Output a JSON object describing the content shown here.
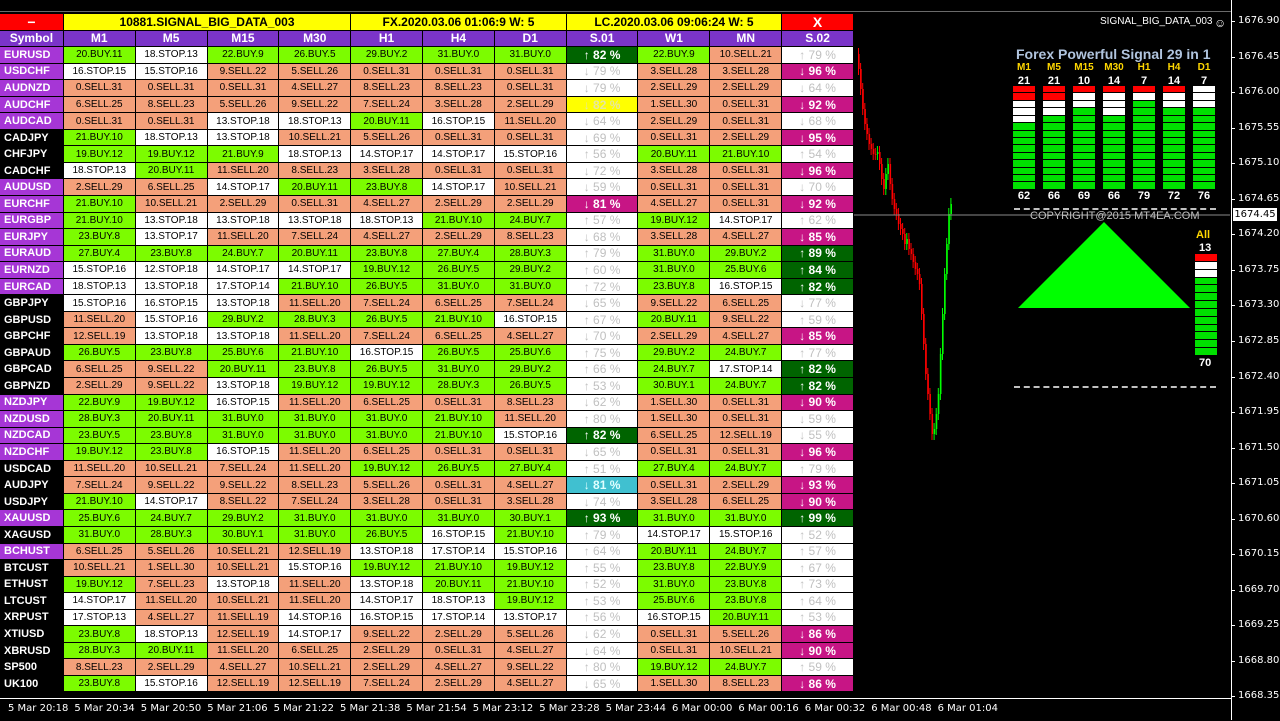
{
  "header": {
    "minimize": "−",
    "title": "10881.SIGNAL_BIG_DATA_003",
    "fx_time": "FX.2020.03.06 01:06:9 W: 5",
    "lc_time": "LC.2020.03.06 09:06:24 W: 5",
    "close": "X"
  },
  "columns": [
    "Symbol",
    "M1",
    "M5",
    "M15",
    "M30",
    "H1",
    "H4",
    "D1",
    "S.01",
    "W1",
    "MN",
    "S.02"
  ],
  "rows": [
    [
      "EURUSD",
      "20.BUY.11",
      "18.STOP.13",
      "22.BUY.9",
      "26.BUY.5",
      "29.BUY.2",
      "31.BUY.0",
      "31.BUY.0",
      "↑ 82 %",
      "22.BUY.9",
      "10.SELL.21",
      "↑ 79 %"
    ],
    [
      "USDCHF",
      "16.STOP.15",
      "15.STOP.16",
      "9.SELL.22",
      "5.SELL.26",
      "0.SELL.31",
      "0.SELL.31",
      "0.SELL.31",
      "↓ 79 %",
      "3.SELL.28",
      "3.SELL.28",
      "↓ 96 %"
    ],
    [
      "AUDNZD",
      "0.SELL.31",
      "0.SELL.31",
      "0.SELL.31",
      "4.SELL.27",
      "8.SELL.23",
      "8.SELL.23",
      "0.SELL.31",
      "↓ 79 %",
      "2.SELL.29",
      "2.SELL.29",
      "↓ 64 %"
    ],
    [
      "AUDCHF",
      "6.SELL.25",
      "8.SELL.23",
      "5.SELL.26",
      "9.SELL.22",
      "7.SELL.24",
      "3.SELL.28",
      "2.SELL.29",
      "↓ 82 %",
      "1.SELL.30",
      "0.SELL.31",
      "↓ 92 %"
    ],
    [
      "AUDCAD",
      "0.SELL.31",
      "0.SELL.31",
      "13.STOP.18",
      "18.STOP.13",
      "20.BUY.11",
      "16.STOP.15",
      "11.SELL.20",
      "↓ 64 %",
      "2.SELL.29",
      "0.SELL.31",
      "↓ 68 %"
    ],
    [
      "CADJPY",
      "21.BUY.10",
      "18.STOP.13",
      "13.STOP.18",
      "10.SELL.21",
      "5.SELL.26",
      "0.SELL.31",
      "0.SELL.31",
      "↓ 69 %",
      "0.SELL.31",
      "2.SELL.29",
      "↓ 95 %"
    ],
    [
      "CHFJPY",
      "19.BUY.12",
      "19.BUY.12",
      "21.BUY.9",
      "18.STOP.13",
      "14.STOP.17",
      "14.STOP.17",
      "15.STOP.16",
      "↑ 56 %",
      "20.BUY.11",
      "21.BUY.10",
      "↑ 54 %"
    ],
    [
      "CADCHF",
      "18.STOP.13",
      "20.BUY.11",
      "11.SELL.20",
      "8.SELL.23",
      "3.SELL.28",
      "0.SELL.31",
      "0.SELL.31",
      "↓ 72 %",
      "3.SELL.28",
      "0.SELL.31",
      "↓ 96 %"
    ],
    [
      "AUDUSD",
      "2.SELL.29",
      "6.SELL.25",
      "14.STOP.17",
      "20.BUY.11",
      "23.BUY.8",
      "14.STOP.17",
      "10.SELL.21",
      "↓ 59 %",
      "0.SELL.31",
      "0.SELL.31",
      "↓ 70 %"
    ],
    [
      "EURCHF",
      "21.BUY.10",
      "10.SELL.21",
      "2.SELL.29",
      "0.SELL.31",
      "4.SELL.27",
      "2.SELL.29",
      "2.SELL.29",
      "↓ 81 %",
      "4.SELL.27",
      "0.SELL.31",
      "↓ 92 %"
    ],
    [
      "EURGBP",
      "21.BUY.10",
      "13.STOP.18",
      "13.STOP.18",
      "13.STOP.18",
      "18.STOP.13",
      "21.BUY.10",
      "24.BUY.7",
      "↑ 57 %",
      "19.BUY.12",
      "14.STOP.17",
      "↑ 62 %"
    ],
    [
      "EURJPY",
      "23.BUY.8",
      "13.STOP.17",
      "11.SELL.20",
      "7.SELL.24",
      "4.SELL.27",
      "2.SELL.29",
      "8.SELL.23",
      "↓ 68 %",
      "3.SELL.28",
      "4.SELL.27",
      "↓ 85 %"
    ],
    [
      "EURAUD",
      "27.BUY.4",
      "23.BUY.8",
      "24.BUY.7",
      "20.BUY.11",
      "23.BUY.8",
      "27.BUY.4",
      "28.BUY.3",
      "↑ 79 %",
      "31.BUY.0",
      "29.BUY.2",
      "↑ 89 %"
    ],
    [
      "EURNZD",
      "15.STOP.16",
      "12.STOP.18",
      "14.STOP.17",
      "14.STOP.17",
      "19.BUY.12",
      "26.BUY.5",
      "29.BUY.2",
      "↑ 60 %",
      "31.BUY.0",
      "25.BUY.6",
      "↑ 84 %"
    ],
    [
      "EURCAD",
      "18.STOP.13",
      "13.STOP.18",
      "17.STOP.14",
      "21.BUY.10",
      "26.BUY.5",
      "31.BUY.0",
      "31.BUY.0",
      "↑ 72 %",
      "23.BUY.8",
      "16.STOP.15",
      "↑ 82 %"
    ],
    [
      "GBPJPY",
      "15.STOP.16",
      "16.STOP.15",
      "13.STOP.18",
      "11.SELL.20",
      "7.SELL.24",
      "6.SELL.25",
      "7.SELL.24",
      "↓ 65 %",
      "9.SELL.22",
      "6.SELL.25",
      "↓ 77 %"
    ],
    [
      "GBPUSD",
      "11.SELL.20",
      "15.STOP.16",
      "29.BUY.2",
      "28.BUY.3",
      "26.BUY.5",
      "21.BUY.10",
      "16.STOP.15",
      "↑ 67 %",
      "20.BUY.11",
      "9.SELL.22",
      "↑ 59 %"
    ],
    [
      "GBPCHF",
      "12.SELL.19",
      "13.STOP.18",
      "13.STOP.18",
      "11.SELL.20",
      "7.SELL.24",
      "6.SELL.25",
      "4.SELL.27",
      "↓ 70 %",
      "2.SELL.29",
      "4.SELL.27",
      "↓ 85 %"
    ],
    [
      "GBPAUD",
      "26.BUY.5",
      "23.BUY.8",
      "25.BUY.6",
      "21.BUY.10",
      "16.STOP.15",
      "26.BUY.5",
      "25.BUY.6",
      "↑ 75 %",
      "29.BUY.2",
      "24.BUY.7",
      "↑ 77 %"
    ],
    [
      "GBPCAD",
      "6.SELL.25",
      "9.SELL.22",
      "20.BUY.11",
      "23.BUY.8",
      "26.BUY.5",
      "31.BUY.0",
      "29.BUY.2",
      "↑ 66 %",
      "24.BUY.7",
      "17.STOP.14",
      "↑ 82 %"
    ],
    [
      "GBPNZD",
      "2.SELL.29",
      "9.SELL.22",
      "13.STOP.18",
      "19.BUY.12",
      "19.BUY.12",
      "28.BUY.3",
      "26.BUY.5",
      "↑ 53 %",
      "30.BUY.1",
      "24.BUY.7",
      "↑ 82 %"
    ],
    [
      "NZDJPY",
      "22.BUY.9",
      "19.BUY.12",
      "16.STOP.15",
      "11.SELL.20",
      "6.SELL.25",
      "0.SELL.31",
      "8.SELL.23",
      "↓ 62 %",
      "1.SELL.30",
      "0.SELL.31",
      "↓ 90 %"
    ],
    [
      "NZDUSD",
      "28.BUY.3",
      "20.BUY.11",
      "31.BUY.0",
      "31.BUY.0",
      "31.BUY.0",
      "21.BUY.10",
      "11.SELL.20",
      "↑ 80 %",
      "1.SELL.30",
      "0.SELL.31",
      "↓ 59 %"
    ],
    [
      "NZDCAD",
      "23.BUY.5",
      "23.BUY.8",
      "31.BUY.0",
      "31.BUY.0",
      "31.BUY.0",
      "21.BUY.10",
      "15.STOP.16",
      "↑ 82 %",
      "6.SELL.25",
      "12.SELL.19",
      "↓ 55 %"
    ],
    [
      "NZDCHF",
      "19.BUY.12",
      "23.BUY.8",
      "16.STOP.15",
      "11.SELL.20",
      "6.SELL.25",
      "0.SELL.31",
      "0.SELL.31",
      "↓ 65 %",
      "0.SELL.31",
      "0.SELL.31",
      "↓ 96 %"
    ],
    [
      "USDCAD",
      "11.SELL.20",
      "10.SELL.21",
      "7.SELL.24",
      "11.SELL.20",
      "19.BUY.12",
      "26.BUY.5",
      "27.BUY.4",
      "↑ 51 %",
      "27.BUY.4",
      "24.BUY.7",
      "↑ 79 %"
    ],
    [
      "AUDJPY",
      "7.SELL.24",
      "9.SELL.22",
      "9.SELL.22",
      "8.SELL.23",
      "5.SELL.26",
      "0.SELL.31",
      "4.SELL.27",
      "↓ 81 %",
      "0.SELL.31",
      "2.SELL.29",
      "↓ 93 %"
    ],
    [
      "USDJPY",
      "21.BUY.10",
      "14.STOP.17",
      "8.SELL.22",
      "7.SELL.24",
      "3.SELL.28",
      "0.SELL.31",
      "3.SELL.28",
      "↓ 74 %",
      "3.SELL.28",
      "6.SELL.25",
      "↓ 90 %"
    ],
    [
      "XAUUSD",
      "25.BUY.6",
      "24.BUY.7",
      "29.BUY.2",
      "31.BUY.0",
      "31.BUY.0",
      "31.BUY.0",
      "30.BUY.1",
      "↑ 93 %",
      "31.BUY.0",
      "31.BUY.0",
      "↑ 99 %"
    ],
    [
      "XAGUSD",
      "31.BUY.0",
      "28.BUY.3",
      "30.BUY.1",
      "31.BUY.0",
      "26.BUY.5",
      "16.STOP.15",
      "21.BUY.10",
      "↑ 79 %",
      "14.STOP.17",
      "15.STOP.16",
      "↑ 52 %"
    ],
    [
      "BCHUST",
      "6.SELL.25",
      "5.SELL.26",
      "10.SELL.21",
      "12.SELL.19",
      "13.STOP.18",
      "17.STOP.14",
      "15.STOP.16",
      "↑ 64 %",
      "20.BUY.11",
      "24.BUY.7",
      "↑ 57 %"
    ],
    [
      "BTCUST",
      "10.SELL.21",
      "1.SELL.30",
      "10.SELL.21",
      "15.STOP.16",
      "19.BUY.12",
      "21.BUY.10",
      "19.BUY.12",
      "↑ 55 %",
      "23.BUY.8",
      "22.BUY.9",
      "↑ 67 %"
    ],
    [
      "ETHUST",
      "19.BUY.12",
      "7.SELL.23",
      "13.STOP.18",
      "11.SELL.20",
      "13.STOP.18",
      "20.BUY.11",
      "21.BUY.10",
      "↑ 52 %",
      "31.BUY.0",
      "23.BUY.8",
      "↑ 73 %"
    ],
    [
      "LTCUST",
      "14.STOP.17",
      "11.SELL.20",
      "10.SELL.21",
      "11.SELL.20",
      "14.STOP.17",
      "18.STOP.13",
      "19.BUY.12",
      "↑ 53 %",
      "25.BUY.6",
      "23.BUY.8",
      "↑ 64 %"
    ],
    [
      "XRPUST",
      "17.STOP.13",
      "4.SELL.27",
      "11.SELL.19",
      "14.STOP.16",
      "16.STOP.15",
      "17.STOP.14",
      "13.STOP.17",
      "↑ 56 %",
      "16.STOP.15",
      "20.BUY.11",
      "↑ 53 %"
    ],
    [
      "XTIUSD",
      "23.BUY.8",
      "18.STOP.13",
      "12.SELL.19",
      "14.STOP.17",
      "9.SELL.22",
      "2.SELL.29",
      "5.SELL.26",
      "↓ 62 %",
      "0.SELL.31",
      "5.SELL.26",
      "↓ 86 %"
    ],
    [
      "XBRUSD",
      "28.BUY.3",
      "20.BUY.11",
      "11.SELL.20",
      "6.SELL.25",
      "2.SELL.29",
      "0.SELL.31",
      "4.SELL.27",
      "↓ 64 %",
      "0.SELL.31",
      "10.SELL.21",
      "↓ 90 %"
    ],
    [
      "SP500",
      "8.SELL.23",
      "2.SELL.29",
      "4.SELL.27",
      "10.SELL.21",
      "2.SELL.29",
      "4.SELL.27",
      "9.SELL.22",
      "↑ 80 %",
      "19.BUY.12",
      "24.BUY.7",
      "↑ 59 %"
    ],
    [
      "UK100",
      "23.BUY.8",
      "15.STOP.16",
      "12.SELL.19",
      "12.SELL.19",
      "7.SELL.24",
      "2.SELL.29",
      "4.SELL.27",
      "↓ 65 %",
      "1.SELL.30",
      "8.SELL.23",
      "↓ 86 %"
    ]
  ],
  "symbol_styles": [
    "p",
    "p",
    "p",
    "p",
    "p",
    "b",
    "b",
    "b",
    "p",
    "p",
    "p",
    "p",
    "p",
    "p",
    "p",
    "b",
    "b",
    "b",
    "b",
    "b",
    "b",
    "p",
    "p",
    "p",
    "p",
    "b",
    "b",
    "b",
    "p",
    "b",
    "p",
    "b",
    "b",
    "b",
    "b",
    "b",
    "b",
    "b",
    "b"
  ],
  "s01_styles": [
    "g",
    "w",
    "w",
    "y",
    "w",
    "w",
    "w",
    "w",
    "w",
    "m",
    "w",
    "w",
    "w",
    "w",
    "w",
    "w",
    "w",
    "w",
    "w",
    "w",
    "w",
    "w",
    "w",
    "g",
    "w",
    "w",
    "c",
    "w",
    "g",
    "w",
    "w",
    "w",
    "w",
    "w",
    "w",
    "w",
    "w",
    "w",
    "w"
  ],
  "s02_styles": [
    "w",
    "m",
    "w",
    "m",
    "w",
    "m",
    "w",
    "m",
    "w",
    "m",
    "w",
    "m",
    "g",
    "g",
    "g",
    "w",
    "w",
    "m",
    "w",
    "g",
    "g",
    "m",
    "w",
    "w",
    "m",
    "w",
    "m",
    "m",
    "g",
    "w",
    "w",
    "w",
    "w",
    "w",
    "w",
    "m",
    "m",
    "w",
    "m"
  ],
  "chart": {
    "indicator_name": "SIGNAL_BIG_DATA_003",
    "price_labels": [
      "1676.90",
      "1676.45",
      "1676.00",
      "1675.55",
      "1675.10",
      "1674.65",
      "1674.20",
      "1673.75",
      "1673.30",
      "1672.85",
      "1672.40",
      "1671.95",
      "1671.50",
      "1671.05",
      "1670.60",
      "1670.15",
      "1669.70",
      "1669.25",
      "1668.80",
      "1668.35"
    ],
    "current_price": "1674.45",
    "time_labels": [
      "5 Mar 20:18",
      "5 Mar 20:34",
      "5 Mar 20:50",
      "5 Mar 21:06",
      "5 Mar 21:22",
      "5 Mar 21:38",
      "5 Mar 21:54",
      "5 Mar 23:12",
      "5 Mar 23:28",
      "5 Mar 23:44",
      "6 Mar 00:00",
      "6 Mar 00:16",
      "6 Mar 00:32",
      "6 Mar 00:48",
      "6 Mar 01:04"
    ]
  },
  "panel": {
    "title": "Forex Powerful Signal 29 in 1",
    "timeframes": [
      {
        "label": "M1",
        "top": "21",
        "bottom": "62",
        "red": 2,
        "white": 3,
        "green": 9
      },
      {
        "label": "M5",
        "top": "21",
        "bottom": "66",
        "red": 2,
        "white": 2,
        "green": 10
      },
      {
        "label": "M15",
        "top": "10",
        "bottom": "69",
        "red": 1,
        "white": 2,
        "green": 11
      },
      {
        "label": "M30",
        "top": "14",
        "bottom": "66",
        "red": 1,
        "white": 3,
        "green": 10
      },
      {
        "label": "H1",
        "top": "7",
        "bottom": "79",
        "red": 1,
        "white": 1,
        "green": 12
      },
      {
        "label": "H4",
        "top": "14",
        "bottom": "72",
        "red": 1,
        "white": 2,
        "green": 11
      },
      {
        "label": "D1",
        "top": "7",
        "bottom": "76",
        "red": 0,
        "white": 3,
        "green": 11
      }
    ],
    "copyright": "COPYRIGHT@2015 MT4EA.COM",
    "all_label": "All",
    "all_top": "13",
    "all_bottom": "70",
    "all_bar": {
      "red": 1,
      "white": 2,
      "green": 10
    }
  },
  "colors": {
    "buy": "#7cfc00",
    "sell": "#f4a07a",
    "stop": "#ffffff",
    "header": "#7b34c9",
    "accent": "#ffff00",
    "candle_bull": "#00ff00",
    "candle_bear": "#ff0000"
  }
}
